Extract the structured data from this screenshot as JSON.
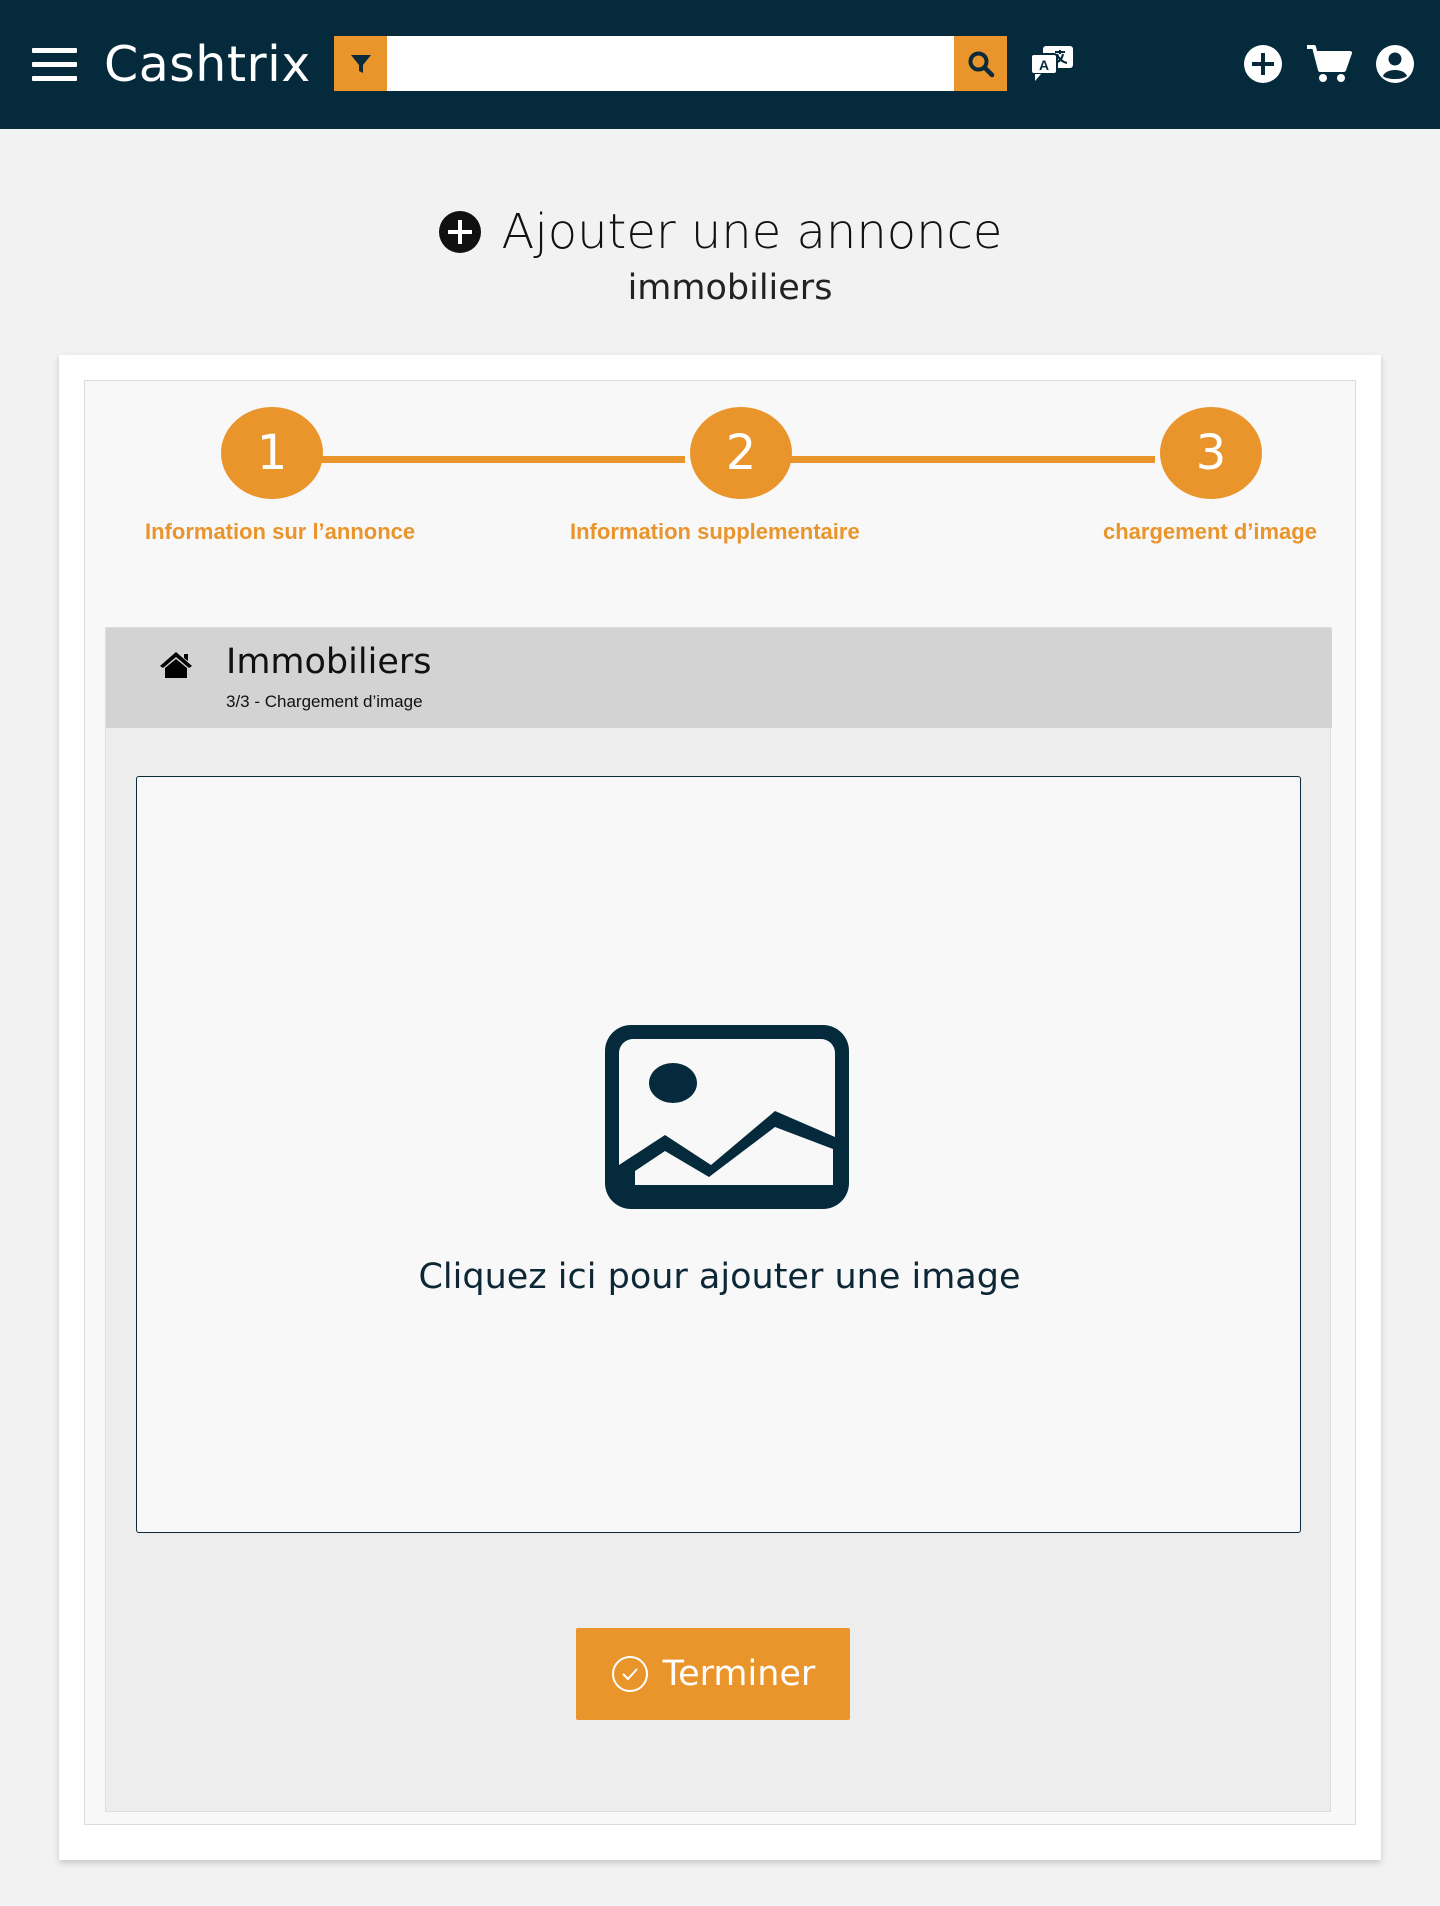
{
  "header": {
    "brand": "Cashtrix",
    "search": {
      "placeholder": "",
      "value": ""
    }
  },
  "page": {
    "title": "Ajouter une annonce",
    "subtitle": "immobiliers"
  },
  "stepper": {
    "steps": [
      {
        "number": "1",
        "label": "Information sur l’annonce"
      },
      {
        "number": "2",
        "label": "Information supplementaire"
      },
      {
        "number": "3",
        "label": "chargement d’image"
      }
    ],
    "current_step": 3
  },
  "section": {
    "title": "Immobiliers",
    "subtitle": "3/3 - Chargement d’image"
  },
  "upload": {
    "label": "Cliquez ici pour ajouter une image"
  },
  "actions": {
    "finish_label": "Terminer"
  },
  "colors": {
    "navbar": "#052a3b",
    "accent": "#ea942c",
    "page_background": "#f2f2f2"
  },
  "icons": [
    "menu-icon",
    "filter-icon",
    "search-icon",
    "translate-icon",
    "add-circle-icon",
    "cart-icon",
    "user-account-icon",
    "home-icon",
    "image-icon",
    "check-circle-icon"
  ]
}
